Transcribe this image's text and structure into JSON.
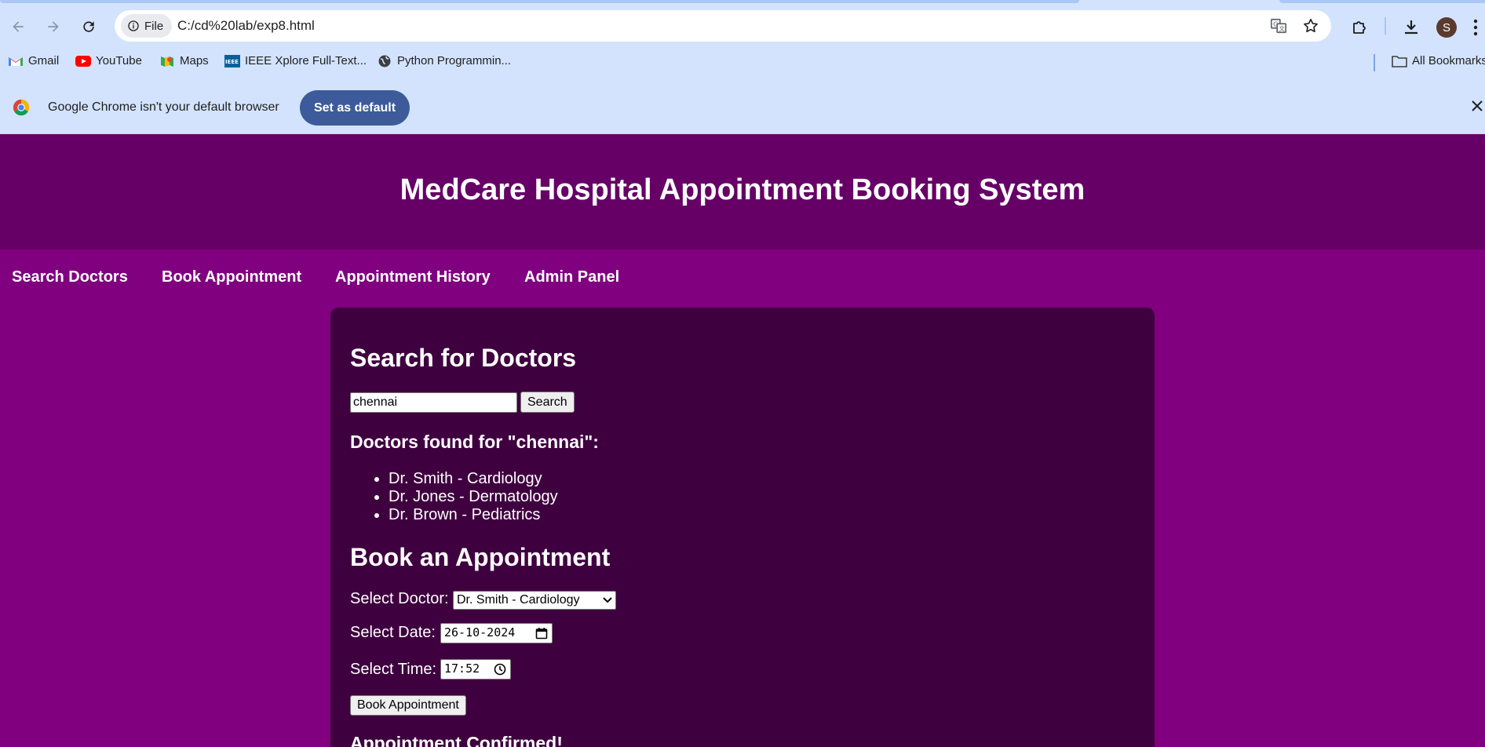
{
  "browser": {
    "chip_label": "File",
    "url": "C:/cd%20lab/exp8.html",
    "avatar_letter": "S",
    "bookmarks": [
      {
        "label": "Gmail",
        "icon": "gmail-icon"
      },
      {
        "label": "YouTube",
        "icon": "youtube-icon"
      },
      {
        "label": "Maps",
        "icon": "maps-icon"
      },
      {
        "label": "IEEE Xplore Full-Text...",
        "icon": "ieee-icon"
      },
      {
        "label": "Python Programmin...",
        "icon": "globe-icon"
      }
    ],
    "all_bookmarks": "All Bookmarks",
    "infobar_text": "Google Chrome isn't your default browser",
    "set_default_label": "Set as default"
  },
  "page": {
    "title": "MedCare Hospital Appointment Booking System",
    "nav": [
      "Search Doctors",
      "Book Appointment",
      "Appointment History",
      "Admin Panel"
    ],
    "search": {
      "heading": "Search for Doctors",
      "value": "chennai",
      "button": "Search",
      "results_heading": "Doctors found for \"chennai\":",
      "results": [
        "Dr. Smith - Cardiology",
        "Dr. Jones - Dermatology",
        "Dr. Brown - Pediatrics"
      ]
    },
    "booking": {
      "heading": "Book an Appointment",
      "doctor_label": "Select Doctor:",
      "doctor_value": "Dr. Smith - Cardiology",
      "date_label": "Select Date:",
      "date_value": "26-10-2024",
      "time_label": "Select Time:",
      "time_value": "17:52",
      "button": "Book Appointment",
      "confirmation": "Appointment Confirmed!"
    }
  },
  "colors": {
    "header_bg": "#660066",
    "page_bg": "#800080",
    "card_bg": "#3f003f",
    "chrome_bg": "#d3e3fd",
    "set_default_bg": "#3d5b9a"
  }
}
